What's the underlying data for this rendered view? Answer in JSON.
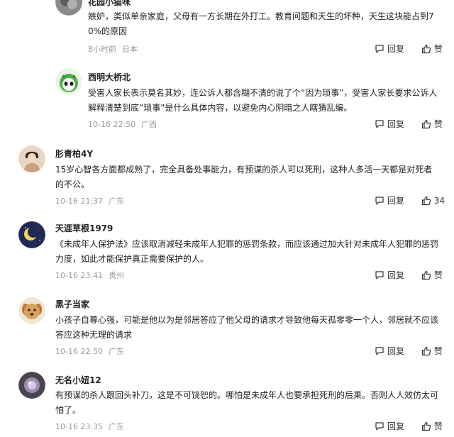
{
  "comments": [
    {
      "name": "花园小猫咪",
      "content": "嫉妒，类似单亲家庭，父母有一方长期在外打工。教育问题和天生的坏种，天生这块能占到70%的原因",
      "time": "8小时前",
      "location": "日本",
      "reply_label": "回复",
      "like_label": "赞",
      "avatar_color": "#8a8a8a"
    },
    {
      "name": "西明大桥北",
      "content": "受害人家长表示莫名其妙，连公诉人都含糊不清的说了个“因为琐事”，受害人家长要求公诉人解释清楚到底“琐事”是什么具体内容，以避免内心阴暗之人瞎猜乱编。",
      "time": "10-16 22:50",
      "location": "广西",
      "reply_label": "回复",
      "like_label": "赞",
      "avatar_color": "#4fae4a"
    },
    {
      "name": "肜青柏4Y",
      "content": "15岁心智各方面都成熟了，完全具备处事能力，有预谋的杀人可以死刑，这种人多活一天都是对死者的不公。",
      "time": "10-16 21:37",
      "location": "广东",
      "reply_label": "回复",
      "like_label": "34",
      "avatar_color": "#c9a27e"
    },
    {
      "name": "天涯草根1979",
      "content": "《未成年人保护法》应该取消减轻未成年人犯罪的惩罚条款，而应该通过加大针对未成年人犯罪的惩罚力度，如此才能保护真正需要保护的人。",
      "time": "10-16 23:41",
      "location": "贵州",
      "reply_label": "回复",
      "like_label": "赞",
      "avatar_color": "#1f2a55"
    },
    {
      "name": "黑子当家",
      "content": "小孩子自尊心强，可能是他以为是邻居答应了他父母的请求才导致他每天孤零零一个人，邻居就不应该答应这种无理的请求",
      "time": "10-16 22:50",
      "location": "广东",
      "reply_label": "回复",
      "like_label": "赞",
      "avatar_color": "#d9a25a"
    },
    {
      "name": "无名小妞12",
      "content": "有预谋的杀人跟回头补刀，这是不可饶恕的。哪怕是未成年人也要承担死刑的后果。否则人人效仿太可怕了。",
      "time": "10-16 23:35",
      "location": "广东",
      "reply_label": "回复",
      "like_label": "赞",
      "avatar_color": "#7a6a8a"
    }
  ]
}
